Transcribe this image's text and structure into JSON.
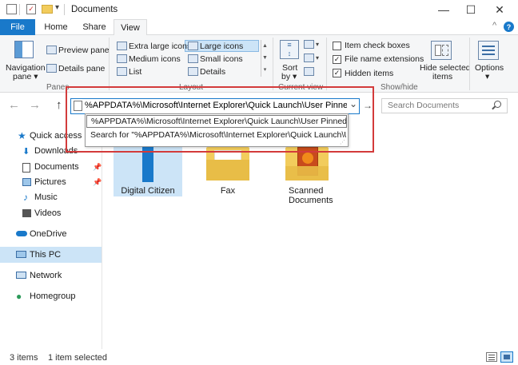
{
  "window": {
    "title": "Documents",
    "minimize": "—",
    "maximize": "☐",
    "close": "✕"
  },
  "qat": {
    "dropdown": "▾"
  },
  "tabs": {
    "file": "File",
    "home": "Home",
    "share": "Share",
    "view": "View"
  },
  "ribbon": {
    "help": "?",
    "collapse": "^",
    "panes": {
      "navigation_pane": "Navigation",
      "navigation_pane_2": "pane ▾",
      "preview_pane": "Preview pane",
      "details_pane": "Details pane",
      "group": "Panes"
    },
    "layout": {
      "extra_large_icons": "Extra large icons",
      "large_icons": "Large icons",
      "medium_icons": "Medium icons",
      "small_icons": "Small icons",
      "list": "List",
      "details": "Details",
      "group": "Layout"
    },
    "current_view": {
      "sort_by": "Sort",
      "sort_by_2": "by ▾",
      "group": "Current view"
    },
    "show_hide": {
      "item_check_boxes": "Item check boxes",
      "file_name_extensions": "File name extensions",
      "hidden_items": "Hidden items",
      "hide_selected": "Hide selected",
      "hide_selected_2": "items",
      "group": "Show/hide",
      "checked_mark": "✓"
    },
    "options": {
      "label": "Options",
      "arrow": "▾"
    }
  },
  "address": {
    "value": "%APPDATA%\\Microsoft\\Internet Explorer\\Quick Launch\\User Pinned\\TaskBar",
    "dropdown_arrow": "⌄",
    "go_arrow": "→",
    "suggestions": [
      "%APPDATA%\\Microsoft\\Internet Explorer\\Quick Launch\\User Pinned\\TaskB",
      "Search for \"%APPDATA%\\Microsoft\\Internet Explorer\\Quick Launch\\User P"
    ]
  },
  "nav": {
    "back": "←",
    "forward": "→",
    "up": "↑"
  },
  "search": {
    "placeholder": "Search Documents"
  },
  "sidebar": {
    "pin_symbol": "📌",
    "items": [
      {
        "label": "Quick access"
      },
      {
        "label": "Downloads"
      },
      {
        "label": "Documents"
      },
      {
        "label": "Pictures"
      },
      {
        "label": "Music"
      },
      {
        "label": "Videos"
      },
      {
        "label": "OneDrive"
      },
      {
        "label": "This PC"
      },
      {
        "label": "Network"
      },
      {
        "label": "Homegroup"
      }
    ]
  },
  "files": [
    {
      "name": "Digital Citizen"
    },
    {
      "name": "Fax"
    },
    {
      "name": "Scanned",
      "name_2": "Documents"
    }
  ],
  "status": {
    "count": "3 items",
    "selected": "1 item selected"
  },
  "colors": {
    "accent": "#1979ca",
    "selection": "#cce4f7",
    "highlight_box": "#d33b3b"
  }
}
